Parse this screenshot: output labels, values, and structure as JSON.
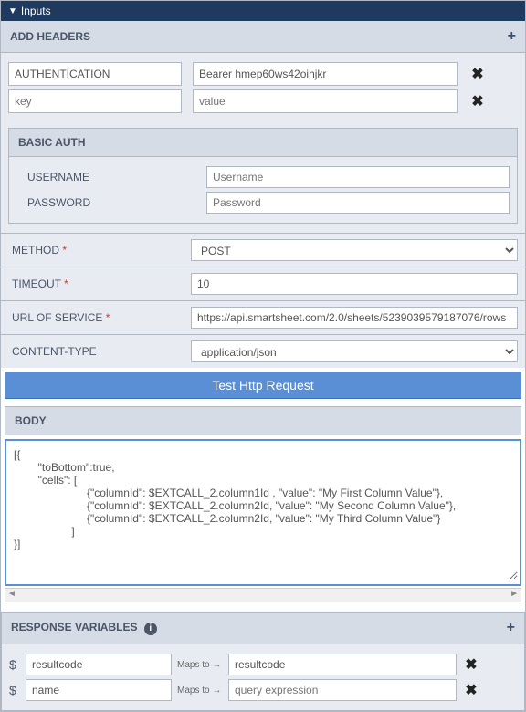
{
  "header": {
    "title": "Inputs"
  },
  "addHeaders": {
    "title": "ADD HEADERS",
    "rows": [
      {
        "key": "AUTHENTICATION",
        "value": "Bearer hmep60ws42oihjkr"
      },
      {
        "key": "",
        "keyPlaceholder": "key",
        "value": "",
        "valuePlaceholder": "value"
      }
    ]
  },
  "basicAuth": {
    "title": "BASIC AUTH",
    "usernameLabel": "USERNAME",
    "usernamePlaceholder": "Username",
    "passwordLabel": "PASSWORD",
    "passwordPlaceholder": "Password"
  },
  "fields": {
    "methodLabel": "METHOD",
    "methodValue": "POST",
    "timeoutLabel": "TIMEOUT",
    "timeoutValue": "10",
    "urlLabel": "URL OF SERVICE",
    "urlValue": "https://api.smartsheet.com/2.0/sheets/5239039579187076/rows",
    "contentTypeLabel": "CONTENT-TYPE",
    "contentTypeValue": "application/json"
  },
  "testButton": "Test Http Request",
  "body": {
    "title": "BODY",
    "content": "[{\n        \"toBottom\":true,\n        \"cells\": [\n                        {\"columnId\": $EXTCALL_2.column1Id , \"value\": \"My First Column Value\"},\n                        {\"columnId\": $EXTCALL_2.column2Id, \"value\": \"My Second Column Value\"},\n                        {\"columnId\": $EXTCALL_2.column2Id, \"value\": \"My Third Column Value\"}\n                   ]\n}]"
  },
  "response": {
    "title": "RESPONSE VARIABLES",
    "mapsTo": "Maps to",
    "rows": [
      {
        "var": "resultcode",
        "expr": "resultcode",
        "exprPlaceholder": ""
      },
      {
        "var": "name",
        "expr": "",
        "exprPlaceholder": "query expression"
      }
    ]
  }
}
